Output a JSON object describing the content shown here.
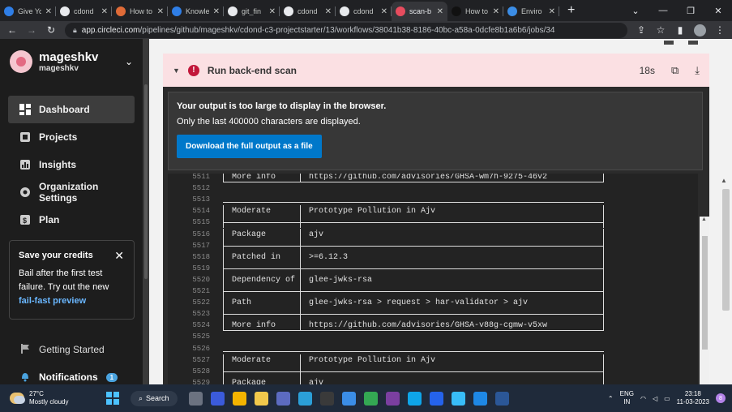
{
  "browser": {
    "tabs": [
      {
        "title": "Give Yo",
        "color": "#2f7ee6"
      },
      {
        "title": "cdond",
        "color": "#e8eaed"
      },
      {
        "title": "How to",
        "color": "#e06b37"
      },
      {
        "title": "Knowle",
        "color": "#2f7ee6"
      },
      {
        "title": "git_fin",
        "color": "#e8eaed"
      },
      {
        "title": "cdond",
        "color": "#e8eaed"
      },
      {
        "title": "cdond",
        "color": "#e8eaed"
      },
      {
        "title": "scan-b",
        "color": "#e74c5e",
        "active": true
      },
      {
        "title": "How to",
        "color": "#111111"
      },
      {
        "title": "Enviro",
        "color": "#3b8de6"
      }
    ],
    "new_tab": "+",
    "url_domain": "app.circleci.com",
    "url_path": "/pipelines/github/mageshkv/cdond-c3-projectstarter/13/workflows/38041b38-8186-40bc-a58a-0dcfe8b1a6b6/jobs/34"
  },
  "sidebar": {
    "user_name": "mageshkv",
    "user_sub": "mageshkv",
    "nav": [
      {
        "label": "Dashboard",
        "icon": "dashboard-icon",
        "active": true
      },
      {
        "label": "Projects",
        "icon": "projects-icon"
      },
      {
        "label": "Insights",
        "icon": "insights-icon"
      },
      {
        "label": "Organization Settings",
        "icon": "gear-icon"
      },
      {
        "label": "Plan",
        "icon": "plan-icon"
      }
    ],
    "credits": {
      "title": "Save your credits",
      "body": "Bail after the first test failure. Try out the new",
      "link": "fail-fast preview"
    },
    "bottom_nav": [
      {
        "label": "Getting Started",
        "icon": "flag-icon"
      },
      {
        "label": "Notifications",
        "icon": "bell-icon",
        "badge": "1"
      }
    ]
  },
  "step": {
    "name": "Run back-end scan",
    "duration": "18s",
    "status_color": "#c2173a"
  },
  "notice": {
    "line1": "Your output is too large to display in the browser.",
    "line2": "Only the last 400000 characters are displayed.",
    "button": "Download the full output as a file"
  },
  "terminal": {
    "lines": [
      {
        "n": "5511",
        "type": "row",
        "k": "More info",
        "v": "https://github.com/advisories/GHSA-wm7h-9275-46v2"
      },
      {
        "n": "5512",
        "type": "blank"
      },
      {
        "n": "5513",
        "type": "blank"
      },
      {
        "n": "5514",
        "type": "row",
        "k": "Moderate",
        "v": "Prototype Pollution in Ajv"
      },
      {
        "n": "5515",
        "type": "sep"
      },
      {
        "n": "5516",
        "type": "row",
        "k": "Package",
        "v": "ajv"
      },
      {
        "n": "5517",
        "type": "sep"
      },
      {
        "n": "5518",
        "type": "row",
        "k": "Patched in",
        "v": ">=6.12.3"
      },
      {
        "n": "5519",
        "type": "sep"
      },
      {
        "n": "5520",
        "type": "row",
        "k": "Dependency of",
        "v": "glee-jwks-rsa"
      },
      {
        "n": "5521",
        "type": "sep"
      },
      {
        "n": "5522",
        "type": "row",
        "k": "Path",
        "v": "glee-jwks-rsa > request > har-validator > ajv"
      },
      {
        "n": "5523",
        "type": "sep"
      },
      {
        "n": "5524",
        "type": "row",
        "k": "More info",
        "v": "https://github.com/advisories/GHSA-v88g-cgmw-v5xw"
      },
      {
        "n": "5525",
        "type": "blank"
      },
      {
        "n": "5526",
        "type": "blank"
      },
      {
        "n": "5527",
        "type": "row",
        "k": "Moderate",
        "v": "Prototype Pollution in Ajv"
      },
      {
        "n": "5528",
        "type": "sep"
      },
      {
        "n": "5529",
        "type": "row",
        "k": "Package",
        "v": "ajv"
      }
    ]
  },
  "taskbar": {
    "temp": "27°C",
    "weather": "Mostly cloudy",
    "search": "Search",
    "lang1": "ENG",
    "lang2": "IN",
    "time": "23:18",
    "date": "11-03-2023",
    "notif": "8",
    "apps": [
      "#6b7280",
      "#3b5bdb",
      "#f4b400",
      "#f2c94c",
      "#5c6bc0",
      "#2b9fd8",
      "#3a3a3a",
      "#3b8de6",
      "#34a853",
      "#7b3fa0",
      "#0ea5e9",
      "#2563eb",
      "#38bdf8",
      "#1e88e5",
      "#2b5797"
    ]
  }
}
